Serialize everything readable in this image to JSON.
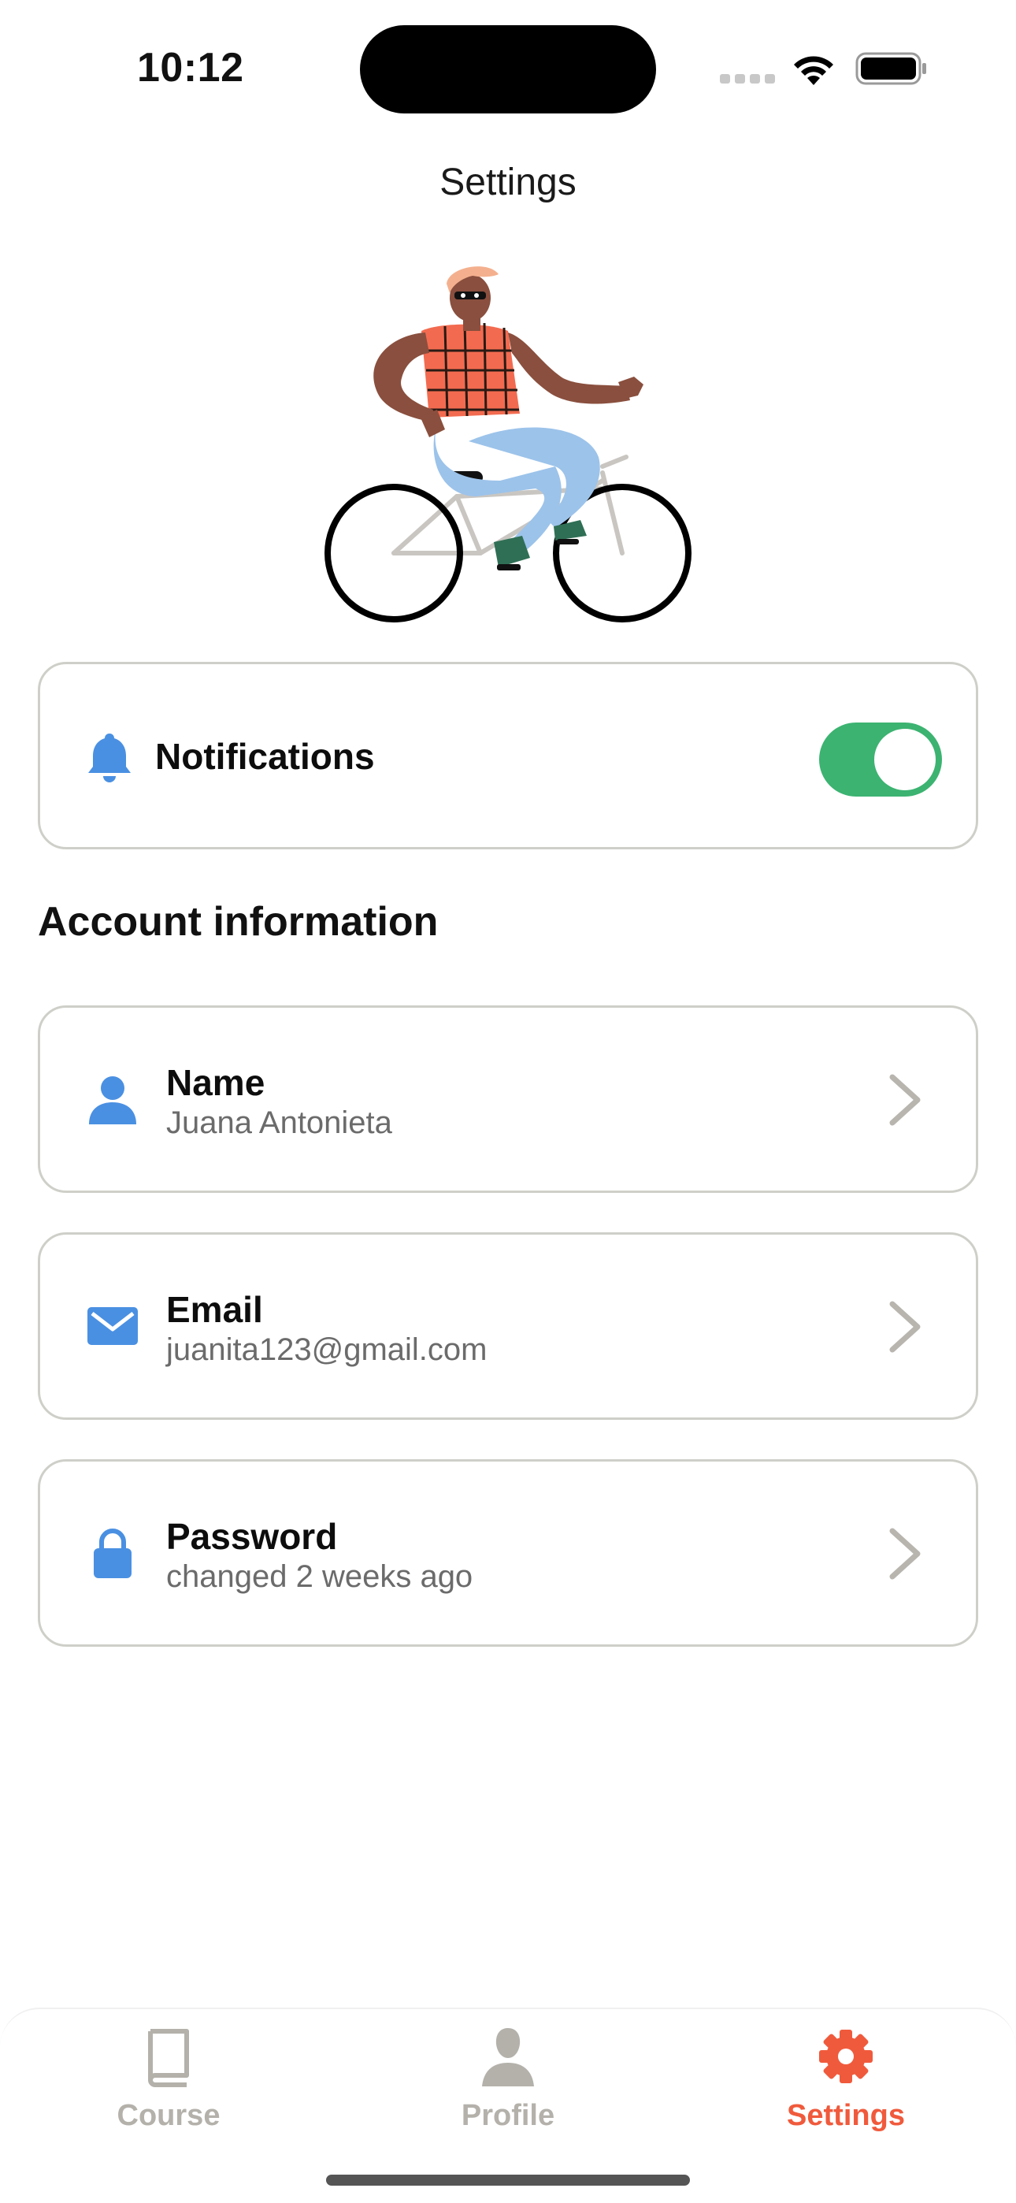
{
  "status_bar": {
    "time": "10:12"
  },
  "header": {
    "title": "Settings"
  },
  "notifications": {
    "label": "Notifications",
    "enabled": true
  },
  "account": {
    "section_title": "Account information",
    "items": [
      {
        "title": "Name",
        "value": "Juana Antonieta",
        "icon": "person-icon"
      },
      {
        "title": "Email",
        "value": "juanita123@gmail.com",
        "icon": "mail-icon"
      },
      {
        "title": "Password",
        "value": "changed 2 weeks ago",
        "icon": "lock-icon"
      }
    ]
  },
  "tab_bar": {
    "tabs": [
      {
        "label": "Course",
        "icon": "book-icon",
        "active": false
      },
      {
        "label": "Profile",
        "icon": "person-icon",
        "active": false
      },
      {
        "label": "Settings",
        "icon": "gear-icon",
        "active": true
      }
    ]
  },
  "colors": {
    "accent": "#f05a3c",
    "icon_blue": "#4a90e2",
    "toggle_on": "#3cb371",
    "inactive_tab": "#b4b1ab",
    "card_border": "#cfcfc9"
  }
}
